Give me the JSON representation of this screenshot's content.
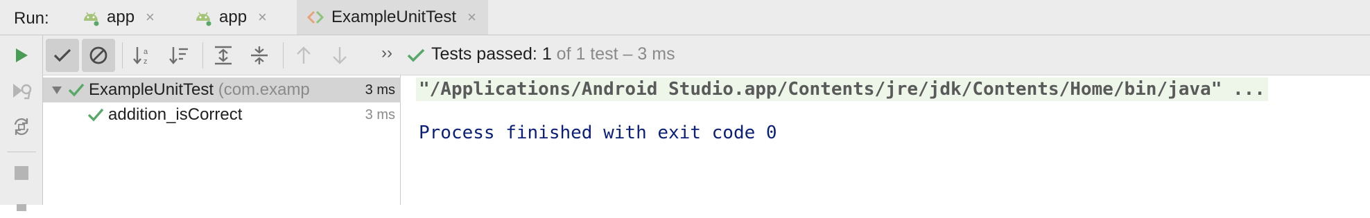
{
  "run_label": "Run:",
  "tabs": [
    {
      "label": "app",
      "icon": "android-icon",
      "close": "×"
    },
    {
      "label": "app",
      "icon": "android-icon",
      "close": "×"
    },
    {
      "label": "ExampleUnitTest",
      "icon": "test-class-icon",
      "close": "×",
      "active": true
    }
  ],
  "toolbar": {
    "buttons": [
      "show-passed",
      "show-ignored",
      "sort-alphabetically",
      "sort-by-duration",
      "expand-all",
      "collapse-all",
      "previous-failed",
      "next-failed"
    ],
    "overflow": "››"
  },
  "status": {
    "main": "Tests passed: ",
    "count": "1",
    "rest": " of 1 test – 3 ms"
  },
  "tree": [
    {
      "name": "ExampleUnitTest",
      "pkg": " (com.examp",
      "duration": "3 ms",
      "status": "passed",
      "expanded": true,
      "selected": true
    },
    {
      "name": "addition_isCorrect",
      "pkg": "",
      "duration": "3 ms",
      "status": "passed"
    }
  ],
  "console": {
    "command": "\"/Applications/Android Studio.app/Contents/jre/jdk/Contents/Home/bin/java\" ...",
    "process": "Process finished with exit code 0"
  },
  "colors": {
    "pass_green": "#59a869",
    "run_green": "#499c54",
    "console_blue": "#0b1f7a",
    "cmd_bg": "#edf6e9"
  }
}
